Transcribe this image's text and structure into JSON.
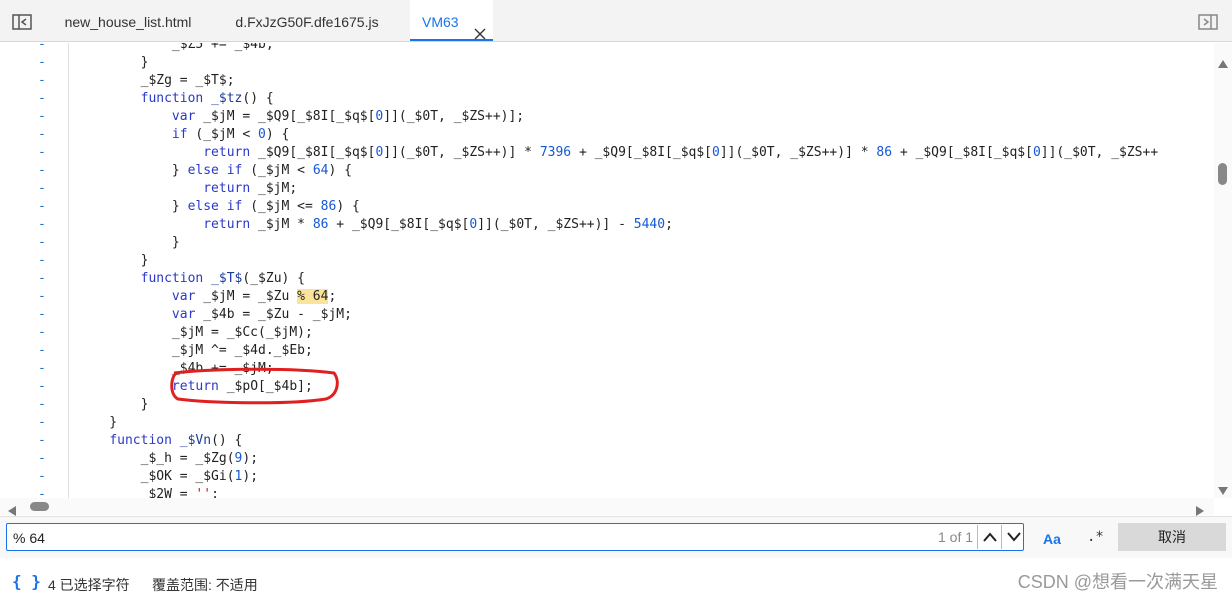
{
  "tabs": [
    {
      "label": "new_house_list.html",
      "active": false
    },
    {
      "label": "d.FxJzG50F.dfe1675.js",
      "active": false
    },
    {
      "label": "VM63",
      "active": true
    }
  ],
  "code_lines": [
    {
      "gutter": "-",
      "segments": [
        {
          "t": "            _$Z5 += _$4b;",
          "c": ""
        }
      ]
    },
    {
      "gutter": "-",
      "segments": [
        {
          "t": "        }",
          "c": ""
        }
      ]
    },
    {
      "gutter": "-",
      "segments": [
        {
          "t": "        _$Zg = _$T$;",
          "c": ""
        }
      ]
    },
    {
      "gutter": "-",
      "segments": [
        {
          "t": "        ",
          "c": ""
        },
        {
          "t": "function",
          "c": "kw"
        },
        {
          "t": " ",
          "c": ""
        },
        {
          "t": "_$tz",
          "c": "fn"
        },
        {
          "t": "() {",
          "c": ""
        }
      ]
    },
    {
      "gutter": "-",
      "segments": [
        {
          "t": "            ",
          "c": ""
        },
        {
          "t": "var",
          "c": "kw"
        },
        {
          "t": " _$jM = _$Q9[_$8I[_$q$[",
          "c": ""
        },
        {
          "t": "0",
          "c": "num"
        },
        {
          "t": "]](_$0T, _$ZS++)];",
          "c": ""
        }
      ]
    },
    {
      "gutter": "-",
      "segments": [
        {
          "t": "            ",
          "c": ""
        },
        {
          "t": "if",
          "c": "kw"
        },
        {
          "t": " (_$jM < ",
          "c": ""
        },
        {
          "t": "0",
          "c": "num"
        },
        {
          "t": ") {",
          "c": ""
        }
      ]
    },
    {
      "gutter": "-",
      "segments": [
        {
          "t": "                ",
          "c": ""
        },
        {
          "t": "return",
          "c": "kw"
        },
        {
          "t": " _$Q9[_$8I[_$q$[",
          "c": ""
        },
        {
          "t": "0",
          "c": "num"
        },
        {
          "t": "]](_$0T, _$ZS++)] * ",
          "c": ""
        },
        {
          "t": "7396",
          "c": "num"
        },
        {
          "t": " + _$Q9[_$8I[_$q$[",
          "c": ""
        },
        {
          "t": "0",
          "c": "num"
        },
        {
          "t": "]](_$0T, _$ZS++)] * ",
          "c": ""
        },
        {
          "t": "86",
          "c": "num"
        },
        {
          "t": " + _$Q9[_$8I[_$q$[",
          "c": ""
        },
        {
          "t": "0",
          "c": "num"
        },
        {
          "t": "]](_$0T, _$ZS++",
          "c": ""
        }
      ]
    },
    {
      "gutter": "-",
      "segments": [
        {
          "t": "            } ",
          "c": ""
        },
        {
          "t": "else",
          "c": "kw"
        },
        {
          "t": " ",
          "c": ""
        },
        {
          "t": "if",
          "c": "kw"
        },
        {
          "t": " (_$jM < ",
          "c": ""
        },
        {
          "t": "64",
          "c": "num"
        },
        {
          "t": ") {",
          "c": ""
        }
      ]
    },
    {
      "gutter": "-",
      "segments": [
        {
          "t": "                ",
          "c": ""
        },
        {
          "t": "return",
          "c": "kw"
        },
        {
          "t": " _$jM;",
          "c": ""
        }
      ]
    },
    {
      "gutter": "-",
      "segments": [
        {
          "t": "            } ",
          "c": ""
        },
        {
          "t": "else",
          "c": "kw"
        },
        {
          "t": " ",
          "c": ""
        },
        {
          "t": "if",
          "c": "kw"
        },
        {
          "t": " (_$jM <= ",
          "c": ""
        },
        {
          "t": "86",
          "c": "num"
        },
        {
          "t": ") {",
          "c": ""
        }
      ]
    },
    {
      "gutter": "-",
      "segments": [
        {
          "t": "                ",
          "c": ""
        },
        {
          "t": "return",
          "c": "kw"
        },
        {
          "t": " _$jM * ",
          "c": ""
        },
        {
          "t": "86",
          "c": "num"
        },
        {
          "t": " + _$Q9[_$8I[_$q$[",
          "c": ""
        },
        {
          "t": "0",
          "c": "num"
        },
        {
          "t": "]](_$0T, _$ZS++)] - ",
          "c": ""
        },
        {
          "t": "5440",
          "c": "num"
        },
        {
          "t": ";",
          "c": ""
        }
      ]
    },
    {
      "gutter": "-",
      "segments": [
        {
          "t": "            }",
          "c": ""
        }
      ]
    },
    {
      "gutter": "-",
      "segments": [
        {
          "t": "        }",
          "c": ""
        }
      ]
    },
    {
      "gutter": "-",
      "segments": [
        {
          "t": "        ",
          "c": ""
        },
        {
          "t": "function",
          "c": "kw"
        },
        {
          "t": " ",
          "c": ""
        },
        {
          "t": "_$T$",
          "c": "fn"
        },
        {
          "t": "(_$Zu) {",
          "c": ""
        }
      ]
    },
    {
      "gutter": "-",
      "segments": [
        {
          "t": "            ",
          "c": ""
        },
        {
          "t": "var",
          "c": "kw"
        },
        {
          "t": " _$jM = _$Zu ",
          "c": ""
        },
        {
          "t": "% 64",
          "c": "hl"
        },
        {
          "t": ";",
          "c": ""
        }
      ]
    },
    {
      "gutter": "-",
      "segments": [
        {
          "t": "            ",
          "c": ""
        },
        {
          "t": "var",
          "c": "kw"
        },
        {
          "t": " _$4b = _$Zu - _$jM;",
          "c": ""
        }
      ]
    },
    {
      "gutter": "-",
      "segments": [
        {
          "t": "            _$jM = _$Cc(_$jM);",
          "c": ""
        }
      ]
    },
    {
      "gutter": "-",
      "segments": [
        {
          "t": "            _$jM ^= _$4d._$Eb;",
          "c": ""
        }
      ]
    },
    {
      "gutter": "-",
      "segments": [
        {
          "t": "            _$4b += _$jM;",
          "c": ""
        }
      ]
    },
    {
      "gutter": "-",
      "segments": [
        {
          "t": "            ",
          "c": ""
        },
        {
          "t": "return",
          "c": "kw"
        },
        {
          "t": " _$pO[_$4b];",
          "c": ""
        }
      ]
    },
    {
      "gutter": "-",
      "segments": [
        {
          "t": "        }",
          "c": ""
        }
      ]
    },
    {
      "gutter": "-",
      "segments": [
        {
          "t": "    }",
          "c": ""
        }
      ]
    },
    {
      "gutter": "-",
      "segments": [
        {
          "t": "    ",
          "c": ""
        },
        {
          "t": "function",
          "c": "kw"
        },
        {
          "t": " ",
          "c": ""
        },
        {
          "t": "_$Vn",
          "c": "fn"
        },
        {
          "t": "() {",
          "c": ""
        }
      ]
    },
    {
      "gutter": "-",
      "segments": [
        {
          "t": "        _$_h = _$Zg(",
          "c": ""
        },
        {
          "t": "9",
          "c": "num"
        },
        {
          "t": ");",
          "c": ""
        }
      ]
    },
    {
      "gutter": "-",
      "segments": [
        {
          "t": "        _$OK = _$Gi(",
          "c": ""
        },
        {
          "t": "1",
          "c": "num"
        },
        {
          "t": ");",
          "c": ""
        }
      ]
    },
    {
      "gutter": "-",
      "segments": [
        {
          "t": "        _$2W = ",
          "c": ""
        },
        {
          "t": "''",
          "c": "str"
        },
        {
          "t": ";",
          "c": ""
        }
      ]
    }
  ],
  "search": {
    "value": "% 64",
    "match_count": "1 of 1",
    "case_label": "Aa",
    "regex_label": ".*",
    "cancel_label": "取消"
  },
  "status": {
    "braces": "{ }",
    "selected": "4 已选择字符",
    "coverage": "覆盖范围: 不适用"
  },
  "watermark": "CSDN @想看一次满天星"
}
